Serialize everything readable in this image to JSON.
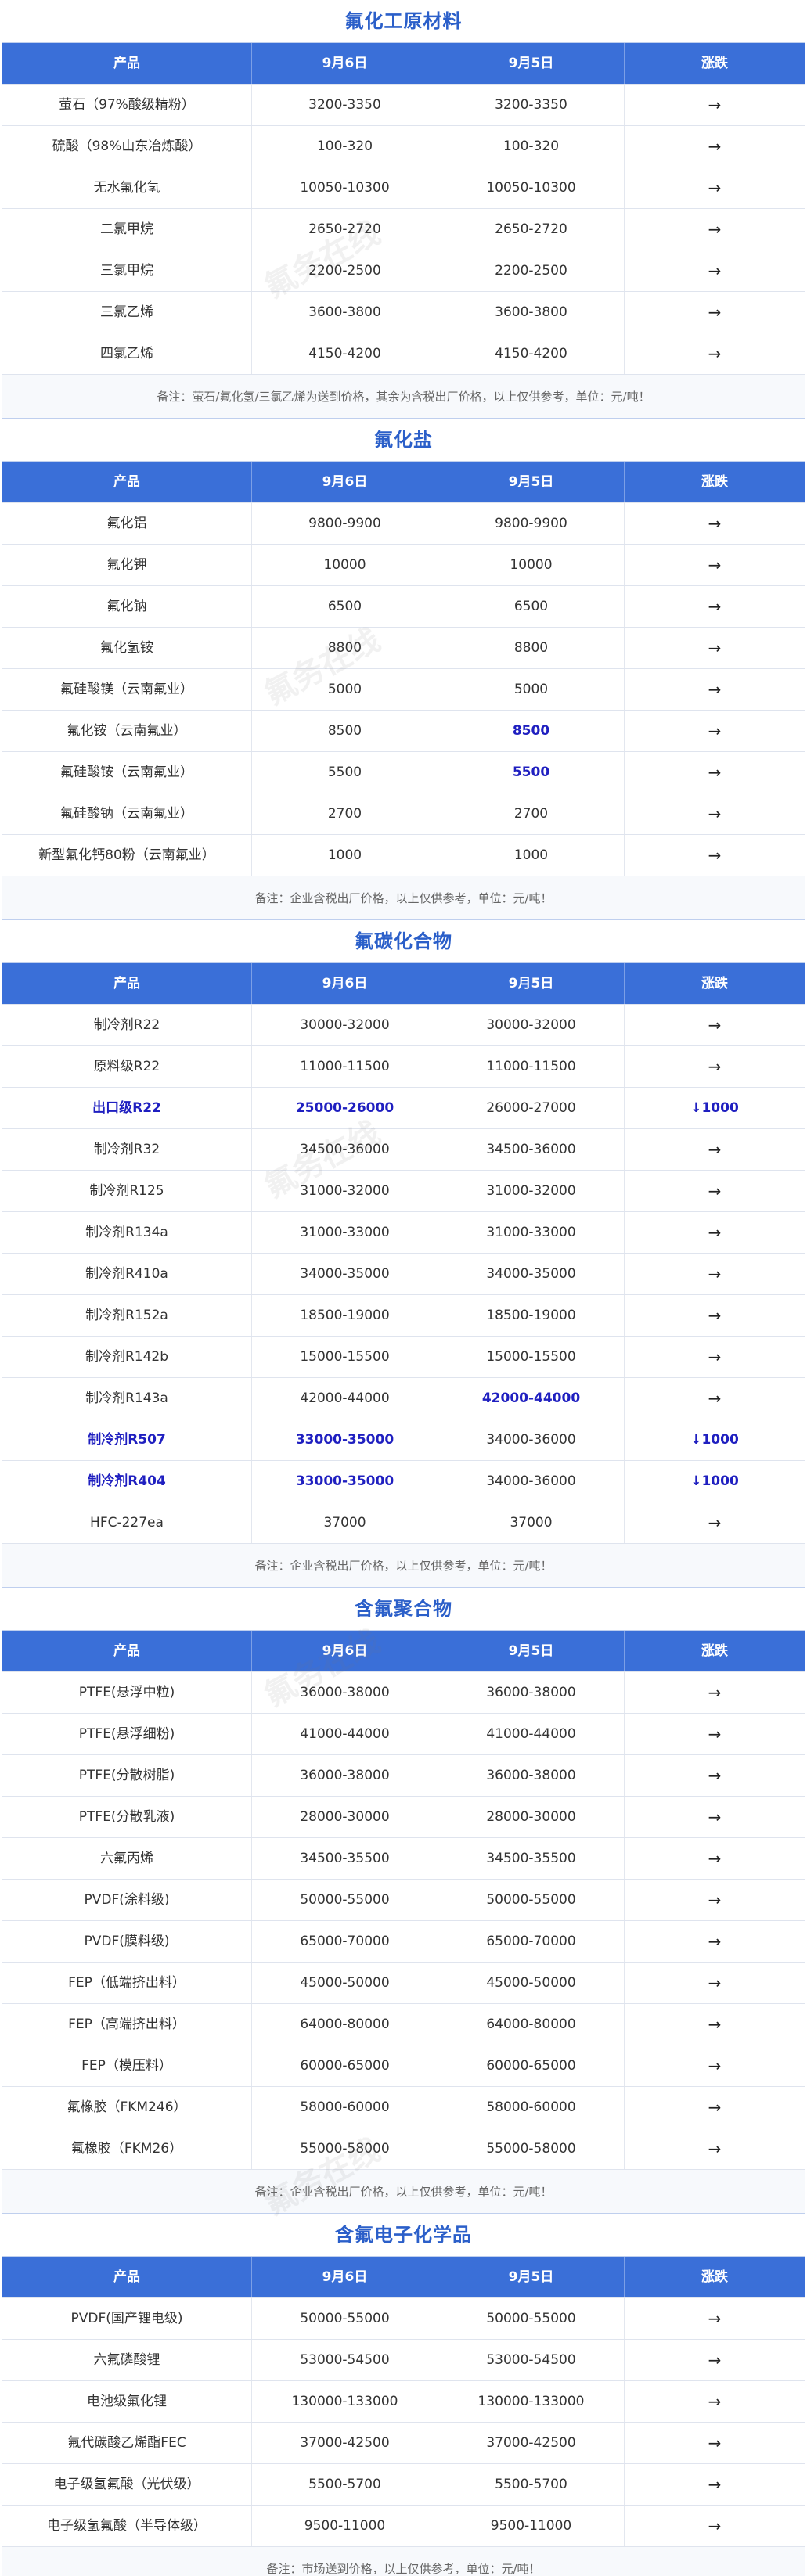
{
  "headers": [
    "产品",
    "9月6日",
    "9月5日",
    "涨跌"
  ],
  "watermark_text": "氟务在线",
  "sections": [
    {
      "title": "氟化工原材料",
      "rows": [
        [
          "萤石（97%酸级精粉）",
          "3200-3350",
          "3200-3350",
          "→"
        ],
        [
          "硫酸（98%山东冶炼酸）",
          "100-320",
          "100-320",
          "→"
        ],
        [
          "无水氟化氢",
          "10050-10300",
          "10050-10300",
          "→"
        ],
        [
          "二氯甲烷",
          "2650-2720",
          "2650-2720",
          "→"
        ],
        [
          "三氯甲烷",
          "2200-2500",
          "2200-2500",
          "→"
        ],
        [
          "三氯乙烯",
          "3600-3800",
          "3600-3800",
          "→"
        ],
        [
          "四氯乙烯",
          "4150-4200",
          "4150-4200",
          "→"
        ]
      ],
      "note": "备注：萤石/氟化氢/三氯乙烯为送到价格，其余为含税出厂价格，以上仅供参考，单位：元/吨！"
    },
    {
      "title": "氟化盐",
      "rows": [
        [
          "氟化铝",
          "9800-9900",
          "9800-9900",
          "→"
        ],
        [
          "氟化钾",
          "10000",
          "10000",
          "→"
        ],
        [
          "氟化钠",
          "6500",
          "6500",
          "→"
        ],
        [
          "氟化氢铵",
          "8800",
          "8800",
          "→"
        ],
        [
          "氟硅酸镁（云南氟业）",
          "5000",
          "5000",
          "→"
        ],
        [
          "氟化铵（云南氟业）",
          "8500",
          "8500",
          "→",
          {
            "hl": [
              2
            ]
          }
        ],
        [
          "氟硅酸铵（云南氟业）",
          "5500",
          "5500",
          "→",
          {
            "hl": [
              2
            ]
          }
        ],
        [
          "氟硅酸钠（云南氟业）",
          "2700",
          "2700",
          "→"
        ],
        [
          "新型氟化钙80粉（云南氟业）",
          "1000",
          "1000",
          "→"
        ]
      ],
      "note": "备注：企业含税出厂价格，以上仅供参考，单位：元/吨！"
    },
    {
      "title": "氟碳化合物",
      "rows": [
        [
          "制冷剂R22",
          "30000-32000",
          "30000-32000",
          "→"
        ],
        [
          "原料级R22",
          "11000-11500",
          "11000-11500",
          "→"
        ],
        [
          "出口级R22",
          "25000-26000",
          "26000-27000",
          "↓1000",
          {
            "hl": [
              0,
              1,
              3
            ]
          }
        ],
        [
          "制冷剂R32",
          "34500-36000",
          "34500-36000",
          "→"
        ],
        [
          "制冷剂R125",
          "31000-32000",
          "31000-32000",
          "→"
        ],
        [
          "制冷剂R134a",
          "31000-33000",
          "31000-33000",
          "→"
        ],
        [
          "制冷剂R410a",
          "34000-35000",
          "34000-35000",
          "→"
        ],
        [
          "制冷剂R152a",
          "18500-19000",
          "18500-19000",
          "→"
        ],
        [
          "制冷剂R142b",
          "15000-15500",
          "15000-15500",
          "→"
        ],
        [
          "制冷剂R143a",
          "42000-44000",
          "42000-44000",
          "→",
          {
            "hl": [
              2
            ]
          }
        ],
        [
          "制冷剂R507",
          "33000-35000",
          "34000-36000",
          "↓1000",
          {
            "hl": [
              0,
              1,
              3
            ]
          }
        ],
        [
          "制冷剂R404",
          "33000-35000",
          "34000-36000",
          "↓1000",
          {
            "hl": [
              0,
              1,
              3
            ]
          }
        ],
        [
          "HFC-227ea",
          "37000",
          "37000",
          "→"
        ]
      ],
      "note": "备注：企业含税出厂价格，以上仅供参考，单位：元/吨！"
    },
    {
      "title": "含氟聚合物",
      "rows": [
        [
          "PTFE(悬浮中粒)",
          "36000-38000",
          "36000-38000",
          "→"
        ],
        [
          "PTFE(悬浮细粉)",
          "41000-44000",
          "41000-44000",
          "→"
        ],
        [
          "PTFE(分散树脂)",
          "36000-38000",
          "36000-38000",
          "→"
        ],
        [
          "PTFE(分散乳液)",
          "28000-30000",
          "28000-30000",
          "→"
        ],
        [
          "六氟丙烯",
          "34500-35500",
          "34500-35500",
          "→"
        ],
        [
          "PVDF(涂料级)",
          "50000-55000",
          "50000-55000",
          "→"
        ],
        [
          "PVDF(膜料级)",
          "65000-70000",
          "65000-70000",
          "→"
        ],
        [
          "FEP（低端挤出料）",
          "45000-50000",
          "45000-50000",
          "→"
        ],
        [
          "FEP（高端挤出料）",
          "64000-80000",
          "64000-80000",
          "→"
        ],
        [
          "FEP（模压料）",
          "60000-65000",
          "60000-65000",
          "→"
        ],
        [
          "氟橡胶（FKM246）",
          "58000-60000",
          "58000-60000",
          "→"
        ],
        [
          "氟橡胶（FKM26）",
          "55000-58000",
          "55000-58000",
          "→"
        ]
      ],
      "note": "备注：企业含税出厂价格，以上仅供参考，单位：元/吨！"
    },
    {
      "title": "含氟电子化学品",
      "rows": [
        [
          "PVDF(国产锂电级)",
          "50000-55000",
          "50000-55000",
          "→"
        ],
        [
          "六氟磷酸锂",
          "53000-54500",
          "53000-54500",
          "→"
        ],
        [
          "电池级氟化锂",
          "130000-133000",
          "130000-133000",
          "→"
        ],
        [
          "氟代碳酸乙烯酯FEC",
          "37000-42500",
          "37000-42500",
          "→"
        ],
        [
          "电子级氢氟酸（光伏级）",
          "5500-5700",
          "5500-5700",
          "→"
        ],
        [
          "电子级氢氟酸（半导体级）",
          "9500-11000",
          "9500-11000",
          "→"
        ]
      ],
      "note": "备注：市场送到价格，以上仅供参考，单位：元/吨！"
    }
  ]
}
